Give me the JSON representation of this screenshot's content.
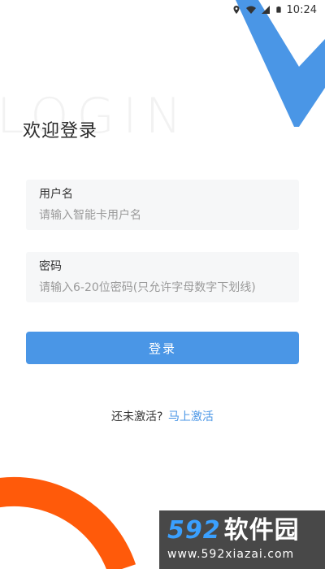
{
  "status_bar": {
    "time": "10:24",
    "icons": [
      "location-icon",
      "wifi-icon",
      "signal-icon",
      "battery-icon"
    ]
  },
  "background": {
    "watermark_text": "LOGIN",
    "accent_blue": "#4a96e6",
    "accent_orange": "#ff5a0a"
  },
  "header": {
    "title": "欢迎登录"
  },
  "form": {
    "username": {
      "label": "用户名",
      "placeholder": "请输入智能卡用户名"
    },
    "password": {
      "label": "密码",
      "placeholder": "请输入6-20位密码(只允许字母数字下划线)"
    },
    "login_button": "登录"
  },
  "activate": {
    "prompt": "还未激活?",
    "link": "马上激活"
  },
  "site_watermark": {
    "brand_number": "592",
    "brand_text": "软件园",
    "url": "www.592xiazai.com"
  }
}
